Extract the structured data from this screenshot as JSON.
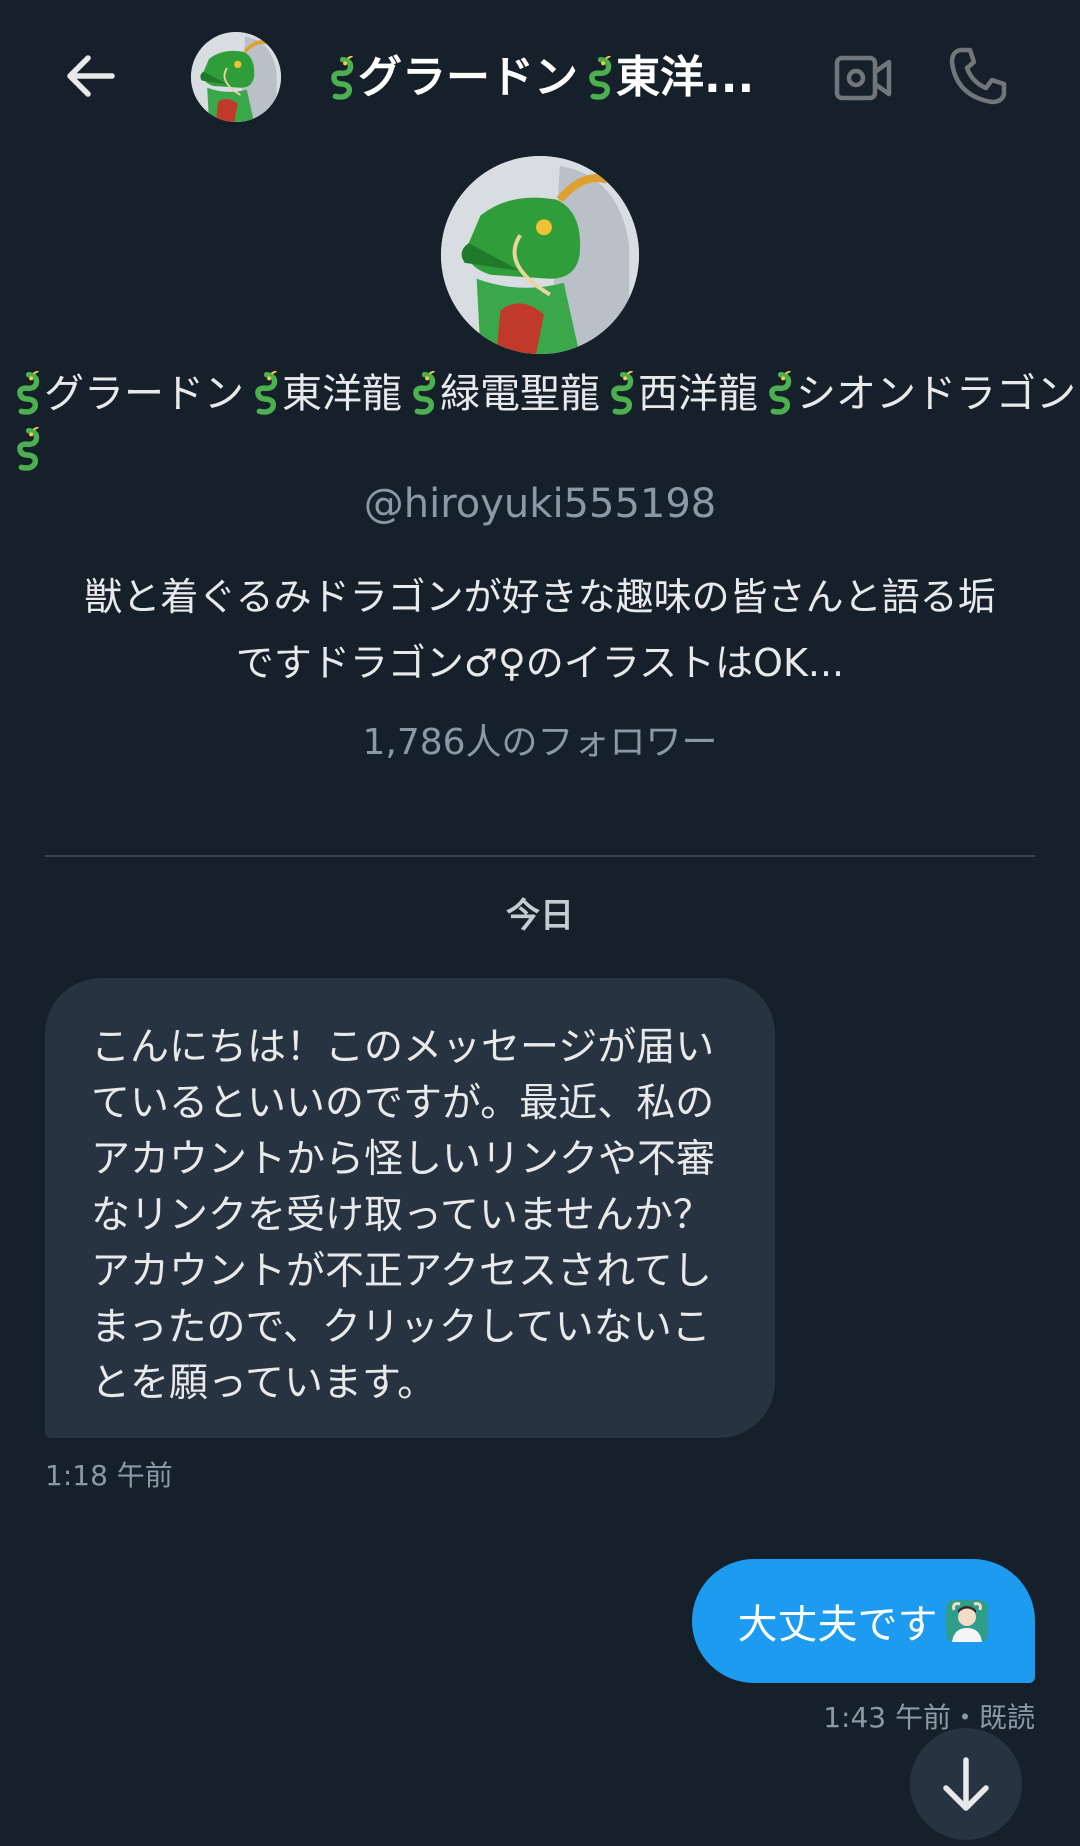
{
  "header": {
    "title": "🐉グラードン🐉東洋..."
  },
  "profile": {
    "display_name": "🐉グラードン🐉東洋龍🐉緑電聖龍🐉西洋龍🐉シオンドラゴン🐉",
    "handle": "@hiroyuki555198",
    "bio": "獣と着ぐるみドラゴンが好きな趣味の皆さんと語る垢ですドラゴン♂♀のイラストはOK...",
    "followers": "1,786人のフォロワー"
  },
  "conversation": {
    "date_separator": "今日",
    "incoming": {
      "text": "こんにちは！このメッセージが届いているといいのですが。最近、私のアカウントから怪しいリンクや不審なリンクを受け取っていませんか？アカウントが不正アクセスされてしまったので、クリックしていないことを願っています。",
      "time": "1:18 午前"
    },
    "outgoing": {
      "text": "大丈夫です",
      "emoji": "person-gesturing-ok-icon",
      "meta": "1:43 午前・既読"
    }
  },
  "colors": {
    "background": "#15202b",
    "incoming_bubble": "#273340",
    "outgoing_bubble": "#1d9bf0",
    "muted_text": "#8b98a5"
  },
  "icons": {
    "back": "arrow-left-icon",
    "video": "video-camera-icon",
    "call": "phone-icon",
    "scroll": "arrow-down-icon"
  }
}
